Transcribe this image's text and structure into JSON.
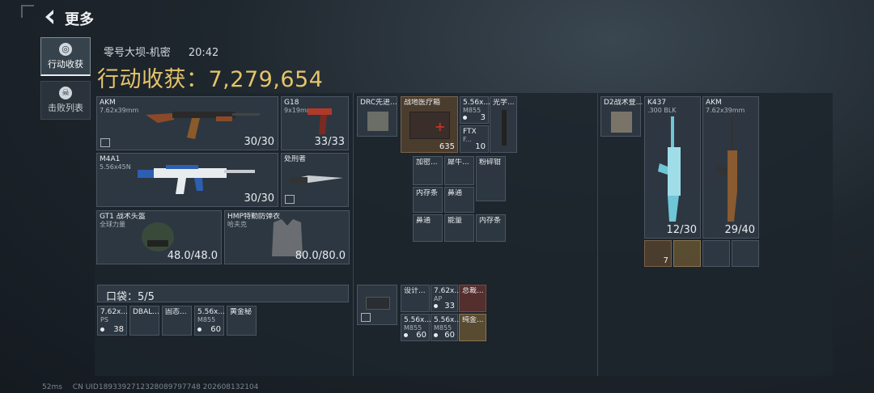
{
  "header": {
    "title": "更多"
  },
  "side_tabs": [
    {
      "label": "行动收获",
      "active": true,
      "icon": "coin-icon"
    },
    {
      "label": "击败列表",
      "active": false,
      "icon": "skull-icon"
    }
  ],
  "raid": {
    "map": "零号大坝-机密",
    "time": "20:42"
  },
  "loot_total": "行动收获：7,279,654",
  "equipment": {
    "primary": {
      "name": "AKM",
      "sub": "7.62x39mm",
      "ammo": "30/30"
    },
    "secondary": {
      "name": "M4A1",
      "sub": "5.56x45N",
      "ammo": "30/30"
    },
    "pistol": {
      "name": "G18",
      "sub": "9x19mm",
      "ammo": "33/33"
    },
    "melee": {
      "name": "处刑者"
    },
    "helmet": {
      "name": "GT1 战术头盔",
      "sub": "全球力量",
      "durability": "48.0/48.0"
    },
    "armor": {
      "name": "HMP特勤防弹衣",
      "sub": "哈夫克",
      "durability": "80.0/80.0"
    }
  },
  "pocket": {
    "label": "口袋：5/5",
    "items": [
      {
        "name": "7.62x...",
        "sub": "PS",
        "count": "38"
      },
      {
        "name": "DBAL...",
        "count": ""
      },
      {
        "name": "固态...",
        "count": ""
      },
      {
        "name": "5.56x...",
        "sub": "M855",
        "count": "60"
      },
      {
        "name": "黄金秘",
        "count": ""
      }
    ]
  },
  "chest_rig": {
    "rig": {
      "name": "DRC先进..."
    },
    "items": [
      {
        "name": "战地医疗箱",
        "count": "635"
      },
      {
        "name": "5.56x...",
        "sub": "M855",
        "count": "3"
      },
      {
        "name": "光学...",
        "count": ""
      },
      {
        "name": "FTX",
        "sub": "F...",
        "count": "10"
      }
    ]
  },
  "rig_sub_items": [
    {
      "name": "加密..."
    },
    {
      "name": "犀牛..."
    },
    {
      "name": "粉碎钳"
    },
    {
      "name": "内存条"
    },
    {
      "name": "鼻通"
    },
    {
      "name": "鼻通"
    },
    {
      "name": "能量"
    },
    {
      "name": "内存条"
    }
  ],
  "backpack": {
    "items": [
      {
        "name": "设计..."
      },
      {
        "name": "7.62x...",
        "sub": "AP",
        "count": "33"
      },
      {
        "name": "总裁..."
      },
      {
        "name": "5.56x...",
        "sub": "M855",
        "count": "60"
      },
      {
        "name": "5.56x...",
        "sub": "M855",
        "count": "60"
      },
      {
        "name": "纯金..."
      }
    ]
  },
  "safe_box": {
    "bag": {
      "name": "D2战术登..."
    },
    "weapons": [
      {
        "name": "K437",
        "sub": ".300 BLK",
        "ammo": "12/30"
      },
      {
        "name": "AKM",
        "sub": "7.62x39mm",
        "ammo": "29/40"
      }
    ],
    "items": [
      {
        "count": "7"
      },
      {
        "count": ""
      },
      {
        "count": ""
      },
      {
        "count": ""
      }
    ]
  },
  "footer": {
    "signal": "52ms",
    "uid": "CN UID1893392712328089797748 202608132104"
  },
  "colors": {
    "gold": "#e6c46a",
    "panel": "#1c242c",
    "slot": "#303a44"
  }
}
